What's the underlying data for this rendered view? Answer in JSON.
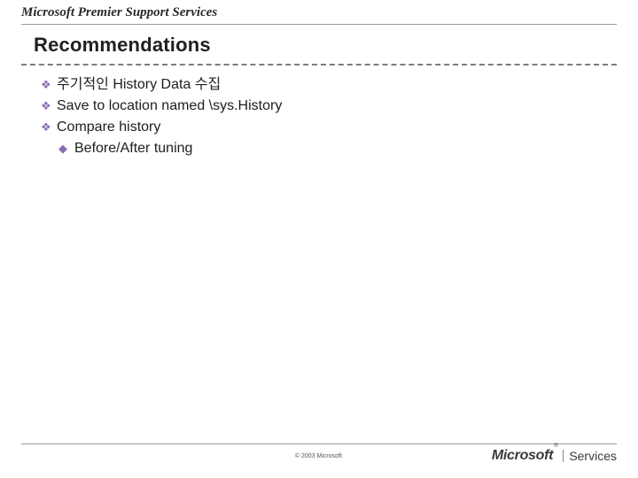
{
  "header": {
    "brand": "Microsoft Premier Support Services"
  },
  "slide": {
    "title": "Recommendations"
  },
  "bullets": [
    {
      "level": 1,
      "text": "주기적인 History Data 수집"
    },
    {
      "level": 1,
      "text": "Save to location named \\sys.History"
    },
    {
      "level": 1,
      "text": "Compare history"
    },
    {
      "level": 2,
      "text": "Before/After tuning"
    }
  ],
  "footer": {
    "copyright": "© 2003 Microsoft",
    "logo_left": "Microsoft",
    "logo_reg": "®",
    "logo_right": "Services"
  },
  "glyphs": {
    "diamond4": "❖",
    "diamond": "◆"
  }
}
